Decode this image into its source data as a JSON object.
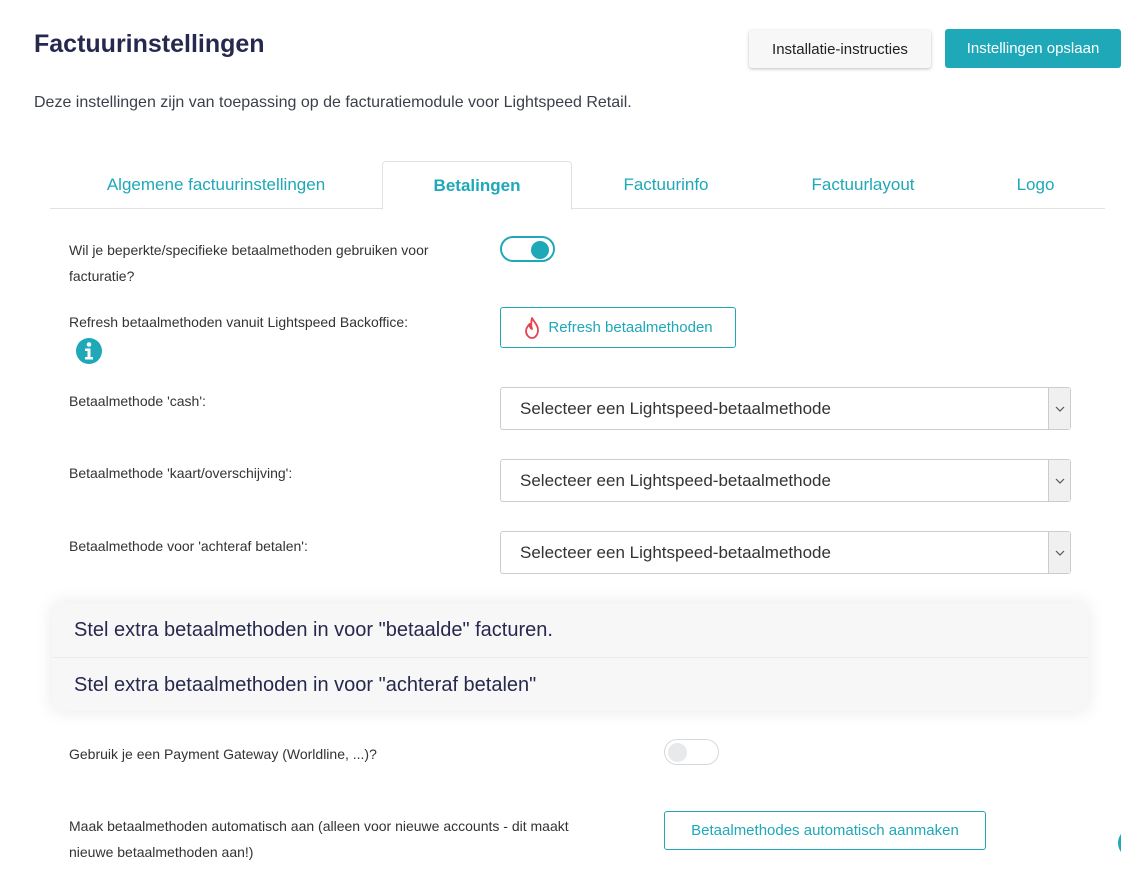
{
  "header": {
    "title": "Factuurinstellingen",
    "install_button": "Installatie-instructies",
    "save_button": "Instellingen opslaan",
    "subtitle": "Deze instellingen zijn van toepassing op de facturatiemodule voor Lightspeed Retail."
  },
  "tabs": [
    {
      "label": "Algemene factuurinstellingen",
      "active": false
    },
    {
      "label": "Betalingen",
      "active": true
    },
    {
      "label": "Factuurinfo",
      "active": false
    },
    {
      "label": "Factuurlayout",
      "active": false
    },
    {
      "label": "Logo",
      "active": false
    }
  ],
  "payments": {
    "restrict_label_line1": "Wil je beperkte/specifieke betaalmethoden gebruiken voor",
    "restrict_label_line2": "facturatie?",
    "restrict_toggle_on": true,
    "refresh_label": "Refresh betaalmethoden vanuit Lightspeed Backoffice:",
    "refresh_button": "Refresh betaalmethoden",
    "refresh_button_icon": "lightspeed-flame-icon",
    "info_icon": "info-icon",
    "selects": [
      {
        "label": "Betaalmethode 'cash':",
        "value": "Selecteer een Lightspeed-betaalmethode"
      },
      {
        "label": "Betaalmethode 'kaart/overschijving':",
        "value": "Selecteer een Lightspeed-betaalmethode"
      },
      {
        "label": "Betaalmethode voor 'achteraf betalen':",
        "value": "Selecteer een Lightspeed-betaalmethode"
      }
    ],
    "accordion": [
      "Stel extra betaalmethoden in voor \"betaalde\" facturen.",
      "Stel extra betaalmethoden in voor \"achteraf betalen\""
    ],
    "gateway_label": "Gebruik je een Payment Gateway (Worldline, ...)?",
    "gateway_toggle_on": false,
    "auto_label_line1": "Maak betaalmethoden automatisch aan (alleen voor nieuwe accounts - dit maakt",
    "auto_label_line2": "nieuwe betaalmethoden aan!)",
    "auto_button": "Betaalmethodes automatisch aanmaken"
  },
  "colors": {
    "accent": "#1ea8b8",
    "title": "#26294d",
    "flame": "#e8424f"
  }
}
